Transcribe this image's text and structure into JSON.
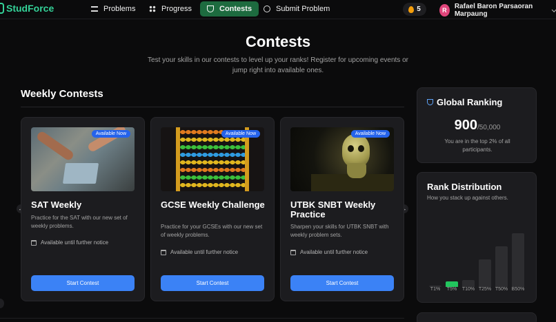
{
  "nav": {
    "brand": "StudForce",
    "items": [
      {
        "label": "Problems",
        "icon": "list-icon"
      },
      {
        "label": "Progress",
        "icon": "grid-icon"
      },
      {
        "label": "Contests",
        "icon": "trophy-icon",
        "active": true
      },
      {
        "label": "Submit Problem",
        "icon": "plus-circle-icon"
      }
    ],
    "streak": "5",
    "user_initial": "R",
    "user_name": "Rafael Baron Parsaoran Marpaung"
  },
  "hero": {
    "title": "Contests",
    "subtitle": "Test your skills in our contests to level up your ranks! Register for upcoming events or jump right into available ones."
  },
  "weekly": {
    "title": "Weekly Contests",
    "cards": [
      {
        "badge": "Available Now",
        "title": "SAT Weekly",
        "desc": "Practice for the SAT with our new set of weekly problems.",
        "availability": "Available until further notice",
        "button": "Start Contest"
      },
      {
        "badge": "Available Now",
        "title": "GCSE Weekly Challenge",
        "desc": "Practice for your GCSEs with our new set of weekly problems.",
        "availability": "Available until further notice",
        "button": "Start Contest"
      },
      {
        "badge": "Available Now",
        "title": "UTBK SNBT Weekly Practice",
        "desc": "Sharpen your skills for UTBK SNBT with weekly problem sets.",
        "availability": "Available until further notice",
        "button": "Start Contest"
      }
    ]
  },
  "ranking": {
    "title": "Global Ranking",
    "rank": "900",
    "total": "/50,000",
    "note": "You are in the top 2% of all participants."
  },
  "distribution": {
    "title": "Rank Distribution",
    "subtitle": "How you stack up against others.",
    "highlight_color": "#22c55e",
    "bars": [
      {
        "label": "T1%",
        "value": 2,
        "you": false
      },
      {
        "label": "T5%",
        "value": 9,
        "you": true
      },
      {
        "label": "T10%",
        "value": 11,
        "you": false
      },
      {
        "label": "T25%",
        "value": 45,
        "you": false
      },
      {
        "label": "T50%",
        "value": 67,
        "you": false
      },
      {
        "label": "B50%",
        "value": 89,
        "you": false
      }
    ]
  }
}
